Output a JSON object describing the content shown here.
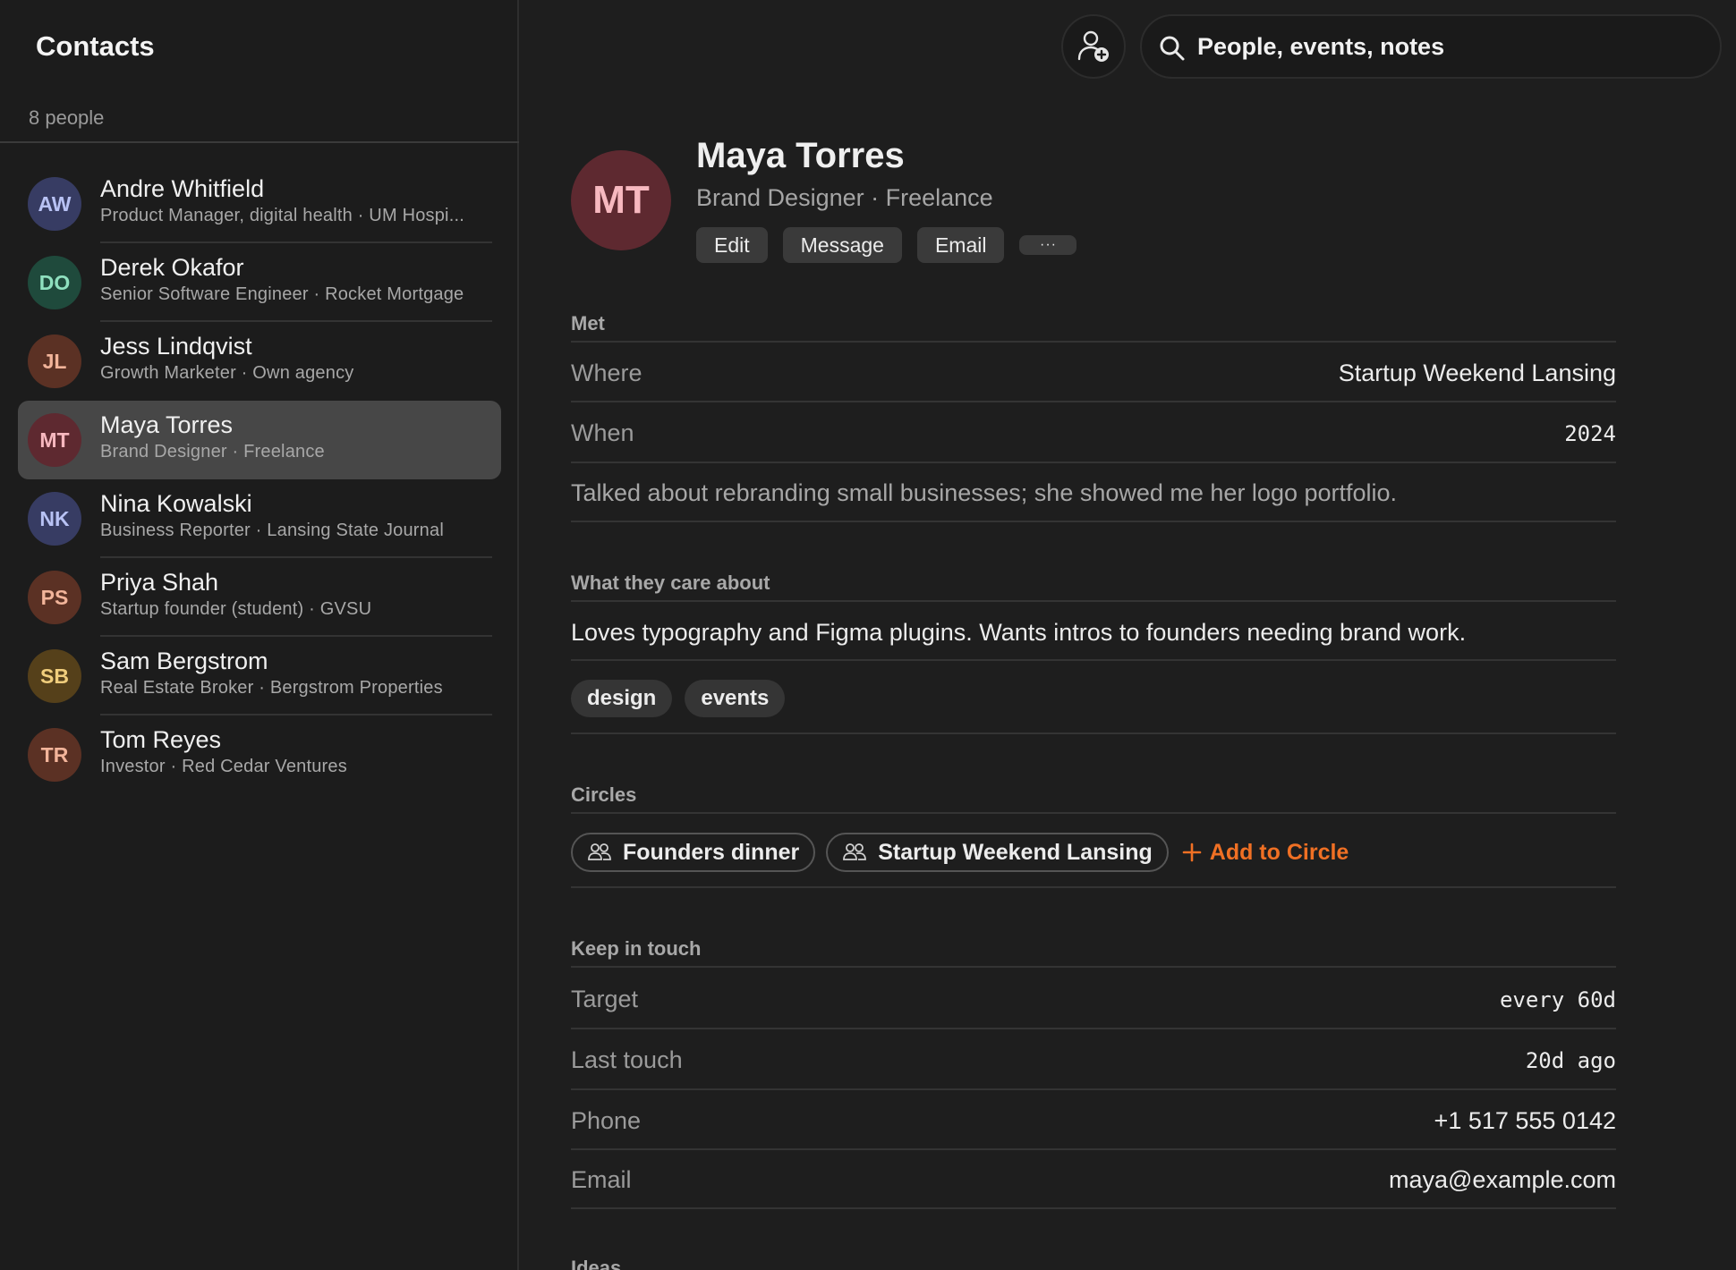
{
  "sidebar": {
    "title": "Contacts",
    "count": "8 people",
    "contacts": [
      {
        "initials": "AW",
        "name": "Andre Whitfield",
        "subtitle": "Product Manager, digital health · UM Hospi...",
        "bg": "#373c63",
        "fg": "#b8c2f4"
      },
      {
        "initials": "DO",
        "name": "Derek Okafor",
        "subtitle": "Senior Software Engineer · Rocket Mortgage",
        "bg": "#1f4a3c",
        "fg": "#8fe0bf"
      },
      {
        "initials": "JL",
        "name": "Jess Lindqvist",
        "subtitle": "Growth Marketer · Own agency",
        "bg": "#5b3124",
        "fg": "#f2b49a"
      },
      {
        "initials": "MT",
        "name": "Maya Torres",
        "subtitle": "Brand Designer · Freelance",
        "bg": "#5e2930",
        "fg": "#f7b8bf",
        "selected": true
      },
      {
        "initials": "NK",
        "name": "Nina Kowalski",
        "subtitle": "Business Reporter · Lansing State Journal",
        "bg": "#373c63",
        "fg": "#b8c2f4"
      },
      {
        "initials": "PS",
        "name": "Priya Shah",
        "subtitle": "Startup founder (student) · GVSU",
        "bg": "#5b3124",
        "fg": "#f2b49a"
      },
      {
        "initials": "SB",
        "name": "Sam Bergstrom",
        "subtitle": "Real Estate Broker · Bergstrom Properties",
        "bg": "#55401a",
        "fg": "#f0cd7c"
      },
      {
        "initials": "TR",
        "name": "Tom Reyes",
        "subtitle": "Investor · Red Cedar Ventures",
        "bg": "#5b3124",
        "fg": "#f2b49a"
      }
    ]
  },
  "topbar": {
    "add_contact_icon": "person-add-icon",
    "search_icon": "search-icon",
    "search_placeholder": "People, events, notes"
  },
  "profile": {
    "initials": "MT",
    "name": "Maya Torres",
    "subtitle": "Brand Designer · Freelance",
    "actions": {
      "edit": "Edit",
      "message": "Message",
      "email": "Email",
      "more": "···"
    },
    "met": {
      "heading": "Met",
      "where_label": "Where",
      "where_value": "Startup Weekend Lansing",
      "when_label": "When",
      "when_value": "2024",
      "note": "Talked about rebranding small businesses; she showed me her logo portfolio."
    },
    "cares": {
      "heading": "What they care about",
      "text": "Loves typography and Figma plugins. Wants intros to founders needing brand work.",
      "tags": [
        "design",
        "events"
      ]
    },
    "circles": {
      "heading": "Circles",
      "items": [
        "Founders dinner",
        "Startup Weekend Lansing"
      ],
      "add_label": "Add to Circle"
    },
    "keep_in_touch": {
      "heading": "Keep in touch",
      "target_label": "Target",
      "target_value": "every 60d",
      "last_label": "Last touch",
      "last_value": "20d ago",
      "phone_label": "Phone",
      "phone_value": "+1 517 555 0142",
      "email_label": "Email",
      "email_value": "maya@example.com"
    },
    "ideas_heading": "Ideas"
  },
  "colors": {
    "accent": "#f07024",
    "background": "#1e1e1e",
    "selected_row": "#474747"
  }
}
